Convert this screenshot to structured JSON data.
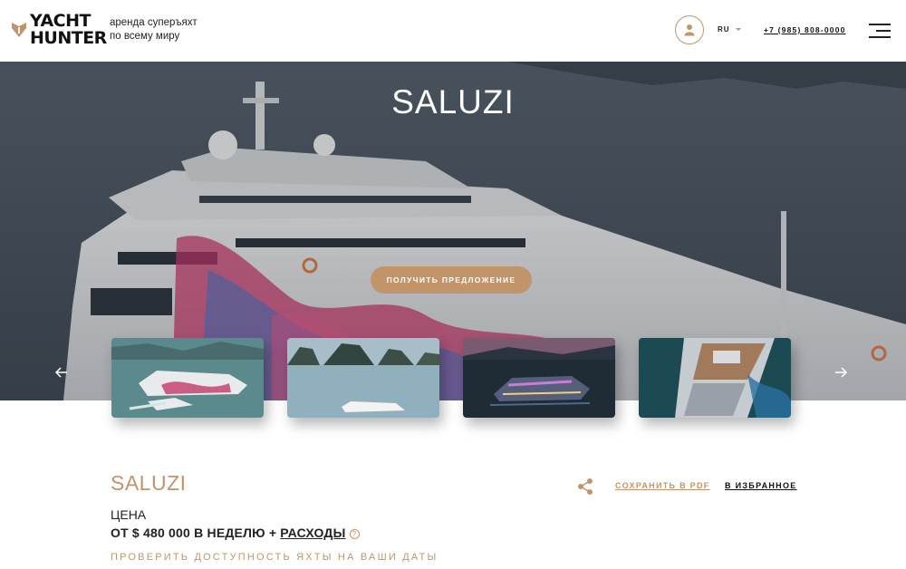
{
  "header": {
    "logo_line1": "YACHT",
    "logo_line2": "HUNTER",
    "tagline_line1": "аренда суперъяхт",
    "tagline_line2": "по всему миру",
    "language": "RU",
    "phone": "+7 (985) 808-0000",
    "icons": [
      "yacht-hunter-logo-icon",
      "user-icon",
      "chevron-down-icon",
      "menu-icon"
    ]
  },
  "hero": {
    "title": "SALUZI",
    "cta_label": "ПОЛУЧИТЬ ПРЕДЛОЖЕНИЕ"
  },
  "gallery": {
    "prev_icon": "arrow-left-icon",
    "next_icon": "arrow-right-icon",
    "thumbnails": [
      "yacht-photo-1",
      "yacht-photo-2",
      "yacht-photo-3",
      "yacht-photo-4"
    ]
  },
  "details": {
    "name": "SALUZI",
    "share_icon": "share-icon",
    "save_pdf": "СОХРАНИТЬ В PDF",
    "add_favorite": "В ИЗБРАННОЕ",
    "price_label": "ЦЕНА",
    "price_text": "ОТ $ 480 000 В НЕДЕЛЮ +",
    "expenses_link": "РАСХОДЫ",
    "help_symbol": "?",
    "check_availability": "ПРОВЕРИТЬ ДОСТУПНОСТЬ ЯХТЫ НА ВАШИ ДАТЫ"
  },
  "colors": {
    "accent": "#c2946a",
    "text": "#1c1c1c",
    "hero_sea": "#45505c"
  }
}
